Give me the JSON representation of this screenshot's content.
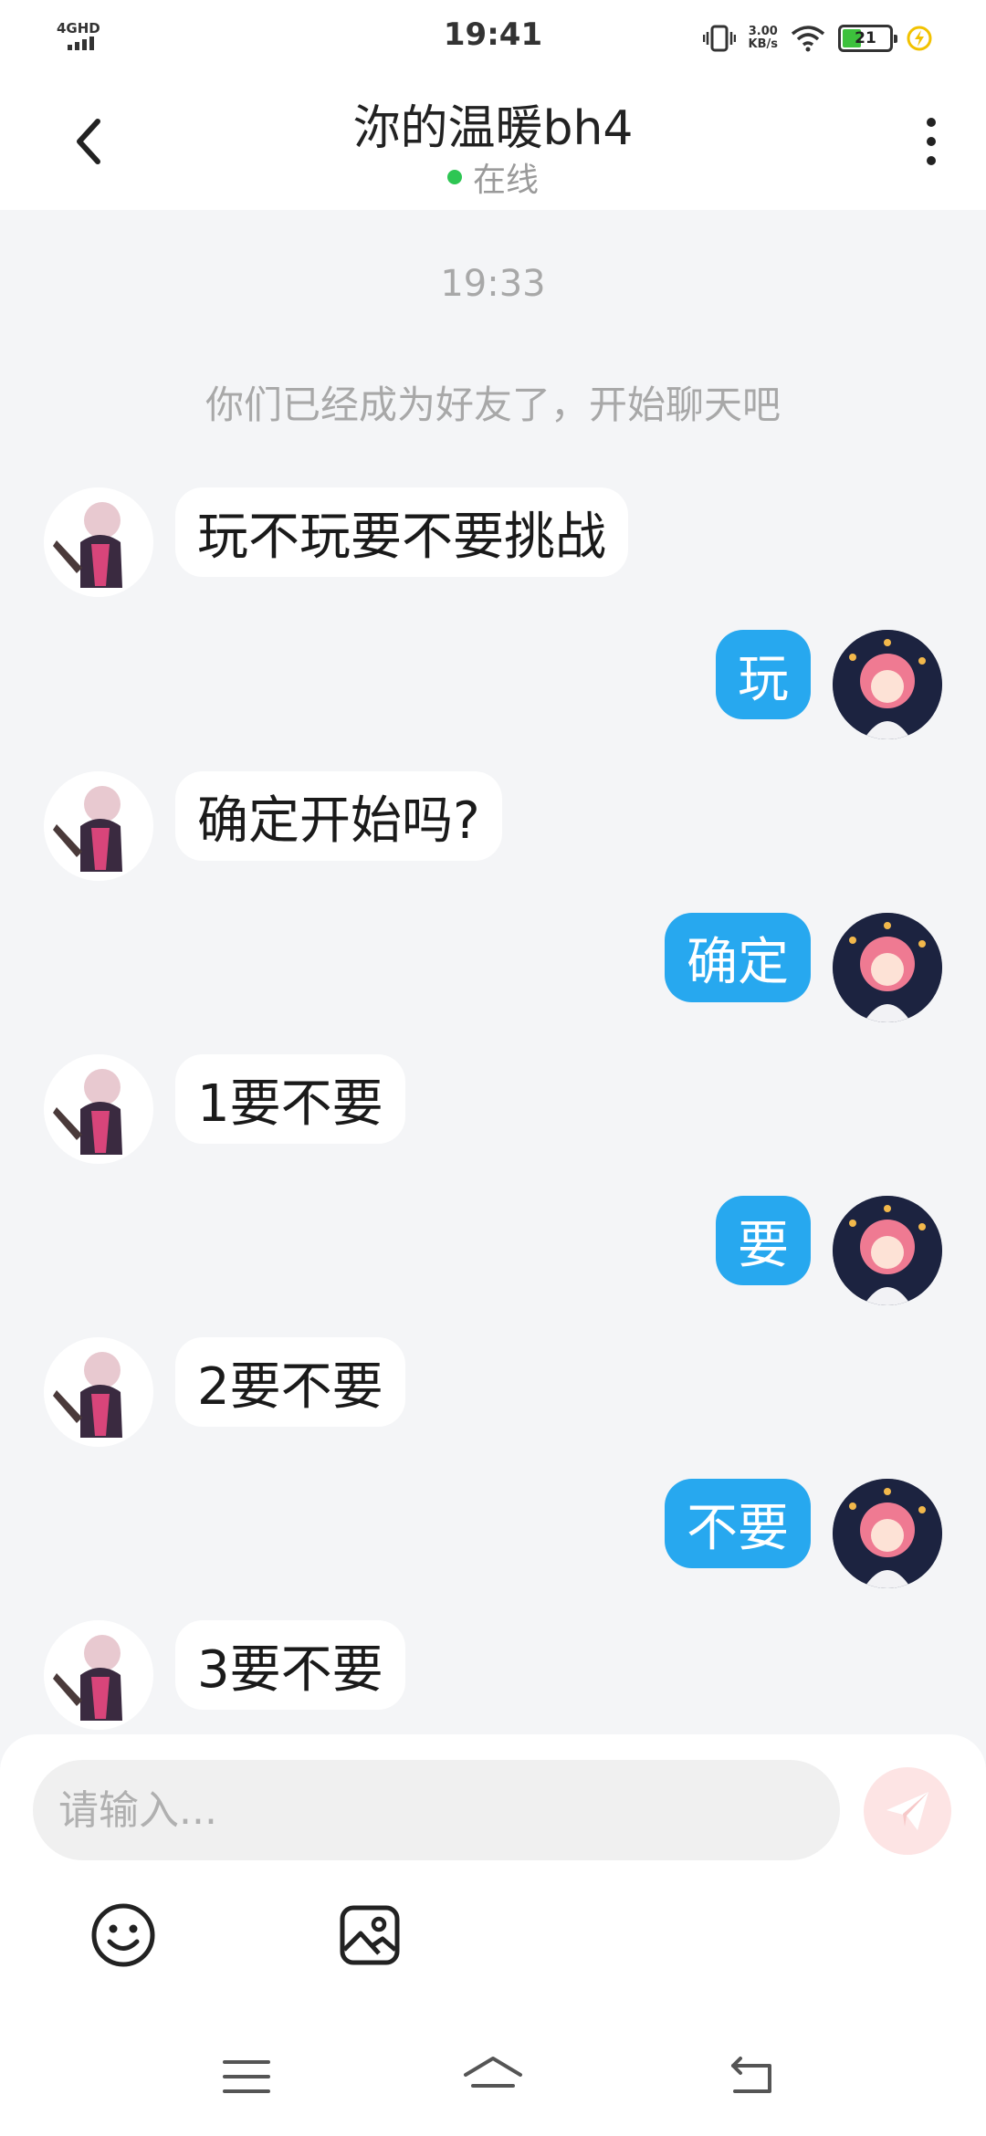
{
  "status_bar": {
    "network": "4GHD",
    "time": "19:41",
    "speed_value": "3.00",
    "speed_unit": "KB/s",
    "battery": "21"
  },
  "header": {
    "contact_name": "沵的温暖bh4",
    "status": "在线",
    "status_color": "#2ec653"
  },
  "chat": {
    "timestamp": "19:33",
    "system_message": "你们已经成为好友了，开始聊天吧",
    "messages": [
      {
        "side": "incoming",
        "text": "玩不玩要不要挑战"
      },
      {
        "side": "outgoing",
        "text": "玩"
      },
      {
        "side": "incoming",
        "text": "确定开始吗?"
      },
      {
        "side": "outgoing",
        "text": "确定"
      },
      {
        "side": "incoming",
        "text": "1要不要"
      },
      {
        "side": "outgoing",
        "text": "要"
      },
      {
        "side": "incoming",
        "text": "2要不要"
      },
      {
        "side": "outgoing",
        "text": "不要"
      },
      {
        "side": "incoming",
        "text": "3要不要"
      }
    ]
  },
  "input": {
    "placeholder": "请输入..."
  },
  "colors": {
    "outgoing_bubble": "#27a8ef",
    "incoming_bubble": "#ffffff",
    "background": "#f4f5f7"
  },
  "icons": {
    "back": "chevron-left-icon",
    "more": "more-vertical-icon",
    "send": "paper-plane-icon",
    "emoji": "smiley-icon",
    "image": "image-icon",
    "nav_menu": "menu-icon",
    "nav_home": "home-icon",
    "nav_back": "back-arrow-icon"
  }
}
